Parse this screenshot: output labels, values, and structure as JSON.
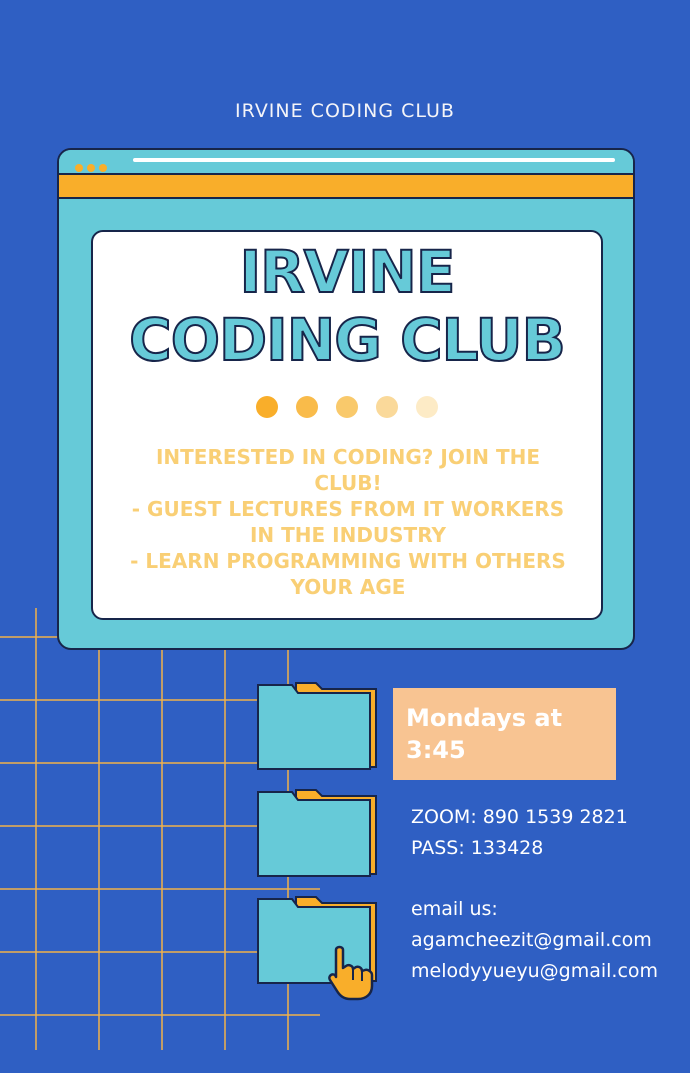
{
  "header": {
    "label": "IRVINE CODING CLUB"
  },
  "poster": {
    "title_line1": "IRVINE",
    "title_line2": "CODING CLUB",
    "description": "INTERESTED IN CODING? JOIN THE CLUB!\n- GUEST LECTURES FROM IT WORKERS IN THE INDUSTRY\n- LEARN PROGRAMMING WITH OTHERS YOUR AGE",
    "dot_colors": [
      "#f9ae2a",
      "#f9bb4a",
      "#f9c96b",
      "#fad99a",
      "#fdebc6"
    ]
  },
  "schedule": {
    "text": "Mondays at\n3:45"
  },
  "zoom": {
    "text": "ZOOM: 890 1539 2821\nPASS: 133428"
  },
  "contact": {
    "text": "email us:\nagamcheezit@gmail.com\nmelodyyueyu@gmail.com"
  },
  "colors": {
    "background": "#2f5fc3",
    "accent_orange": "#f9ae2a",
    "accent_teal": "#66cad8",
    "outline": "#17254a",
    "peach": "#f8c492"
  },
  "icons": [
    "folder-icon",
    "folder-icon",
    "folder-icon",
    "pointer-hand-icon",
    "window-dots-icon"
  ]
}
